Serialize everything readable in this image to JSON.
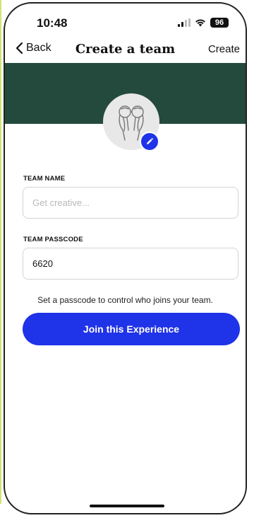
{
  "status_bar": {
    "time": "10:48",
    "battery": "96",
    "icons": [
      "signal-icon",
      "wifi-icon",
      "battery-icon"
    ]
  },
  "nav": {
    "back_label": "Back",
    "title": "Create a team",
    "create_label": "Create",
    "back_icon": "chevron-left-icon"
  },
  "header": {
    "banner_color": "#234a3d",
    "avatar_icon": "binoculars-hands-illustration",
    "edit_icon": "pencil-icon"
  },
  "form": {
    "team_name": {
      "label": "TEAM NAME",
      "placeholder": "Get creative...",
      "value": ""
    },
    "team_passcode": {
      "label": "TEAM PASSCODE",
      "value": "6620"
    },
    "hint": "Set a passcode to control who joins your team.",
    "submit_label": "Join this Experience"
  },
  "colors": {
    "accent": "#1f33e8",
    "banner": "#234a3d"
  }
}
